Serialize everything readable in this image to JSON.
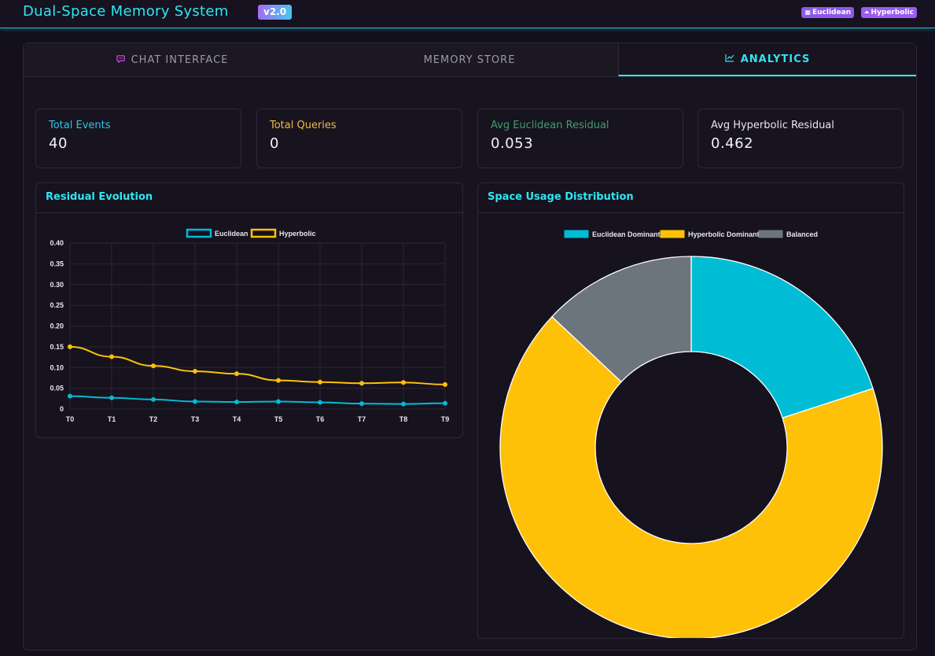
{
  "header": {
    "title": "Dual-Space Memory System",
    "version": "v2.0",
    "badges": [
      {
        "icon": "grid-icon",
        "glyph": "▦",
        "label": "Euclidean"
      },
      {
        "icon": "triangle-icon",
        "glyph": "⏶",
        "label": "Hyperbolic"
      }
    ]
  },
  "tabs": [
    {
      "label": "CHAT INTERFACE",
      "icon": "chat-icon",
      "glyph": "💬",
      "active": false
    },
    {
      "label": "MEMORY STORE",
      "active": false
    },
    {
      "label": "ANALYTICS",
      "icon": "chart-icon",
      "glyph": "📈",
      "active": true
    }
  ],
  "stats": [
    {
      "label": "Total Events",
      "value": "40",
      "color": "#2ec6e8"
    },
    {
      "label": "Total Queries",
      "value": "0",
      "color": "#f5b942"
    },
    {
      "label": "Avg Euclidean Residual",
      "value": "0.053",
      "color": "#3f9e6a"
    },
    {
      "label": "Avg Hyperbolic Residual",
      "value": "0.462",
      "color": "#e8e6ef"
    }
  ],
  "colors": {
    "euclidean": "#00bcd4",
    "hyperbolic": "#ffc107",
    "balanced": "#6c757d"
  },
  "chart_data": [
    {
      "type": "line",
      "title": "Residual Evolution",
      "x": [
        "T0",
        "T1",
        "T2",
        "T3",
        "T4",
        "T5",
        "T6",
        "T7",
        "T8",
        "T9"
      ],
      "series": [
        {
          "name": "Euclidean",
          "values": [
            0.031,
            0.027,
            0.023,
            0.018,
            0.017,
            0.018,
            0.016,
            0.013,
            0.012,
            0.014
          ]
        },
        {
          "name": "Hyperbolic",
          "values": [
            0.15,
            0.126,
            0.104,
            0.091,
            0.085,
            0.069,
            0.065,
            0.062,
            0.064,
            0.059
          ]
        }
      ],
      "yticks": [
        "0",
        "0.05",
        "0.10",
        "0.15",
        "0.20",
        "0.25",
        "0.30",
        "0.35",
        "0.40"
      ],
      "ylim": [
        0,
        0.4
      ],
      "grid": true,
      "legend": "top-center"
    },
    {
      "type": "pie",
      "title": "Space Usage Distribution",
      "categories": [
        "Euclidean Dominant",
        "Hyperbolic Dominant",
        "Balanced"
      ],
      "values": [
        20,
        67,
        13
      ],
      "doughnut": true,
      "legend": "top-center"
    }
  ]
}
